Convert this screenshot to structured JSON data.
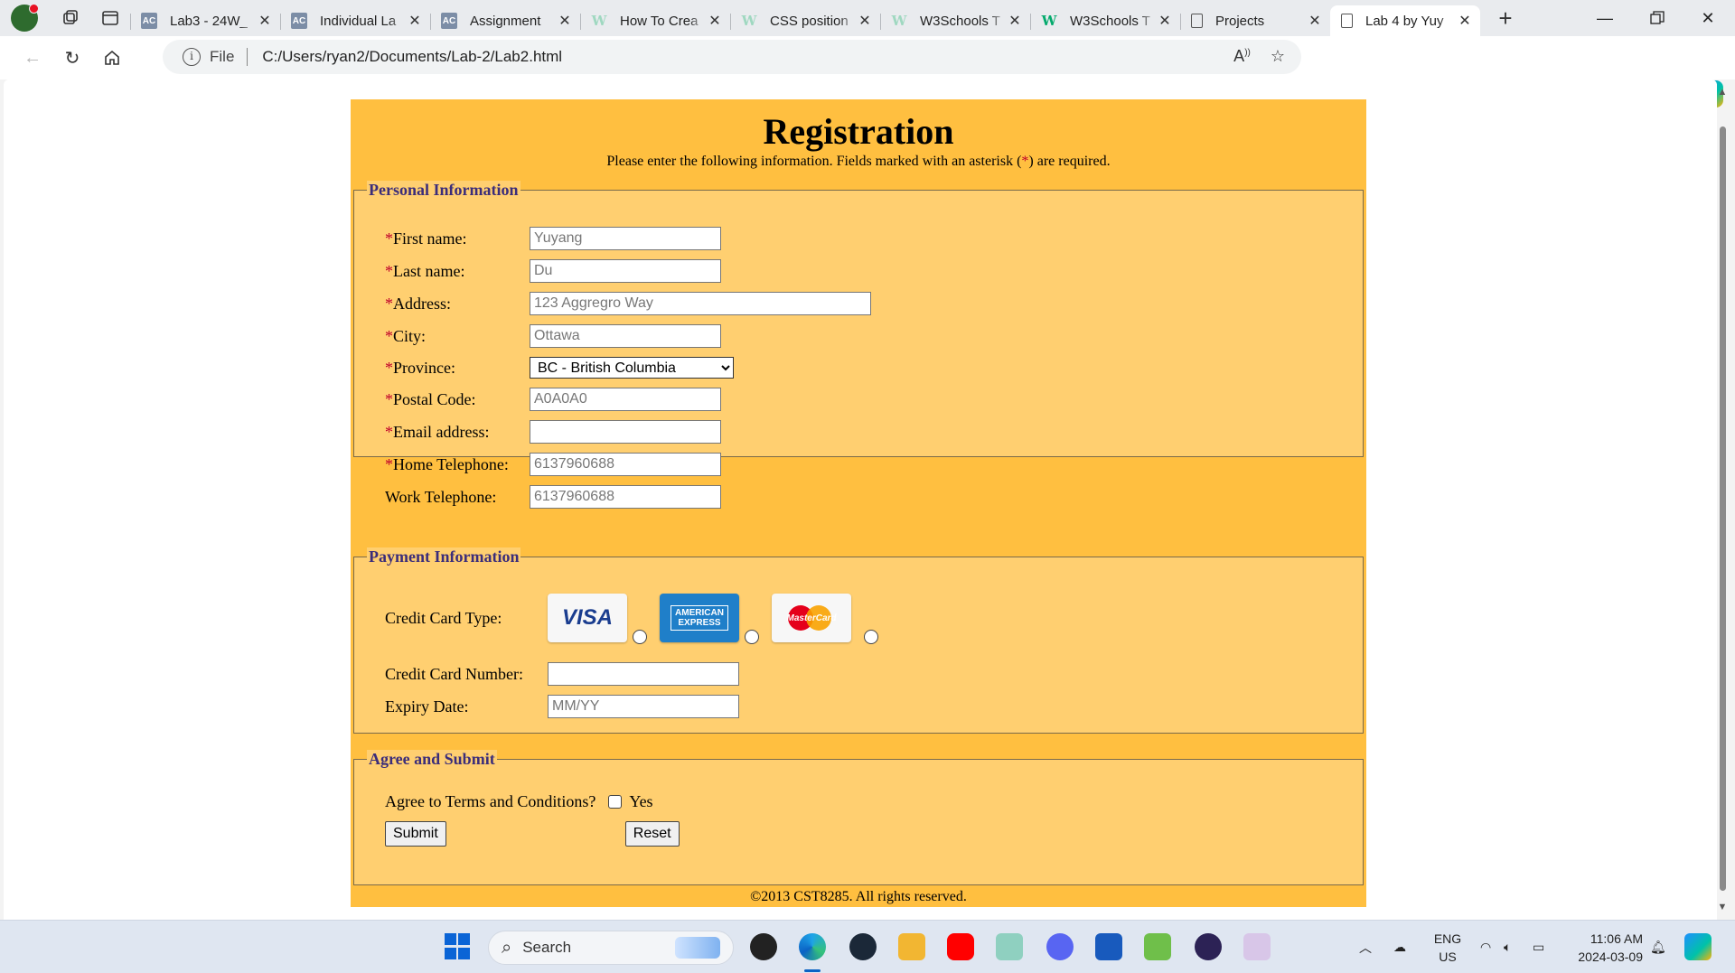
{
  "browser": {
    "tabs": [
      {
        "label": "Lab3 - 24W_",
        "icon": "ac-icon"
      },
      {
        "label": "Individual La",
        "icon": "ac-icon"
      },
      {
        "label": "Assignment",
        "icon": "ac-icon"
      },
      {
        "label": "How To Crea",
        "icon": "w3schools-icon"
      },
      {
        "label": "CSS position",
        "icon": "w3schools-icon"
      },
      {
        "label": "W3Schools T",
        "icon": "w3schools-icon"
      },
      {
        "label": "W3Schools T",
        "icon": "w3schools-icon"
      },
      {
        "label": "Projects",
        "icon": "document-icon"
      },
      {
        "label": "Lab 4 by Yuy",
        "icon": "document-icon",
        "active": true
      }
    ],
    "address": {
      "scheme_label": "File",
      "url": "C:/Users/ryan2/Documents/Lab-2/Lab2.html"
    }
  },
  "form": {
    "title": "Registration",
    "subtitle_pre": "Please enter the following information. Fields marked with an asterisk (",
    "subtitle_star": "*",
    "subtitle_post": ") are required.",
    "asterisk": "*",
    "personal": {
      "legend": "Personal Information",
      "first_name": {
        "label": "First name:",
        "placeholder": "Yuyang"
      },
      "last_name": {
        "label": "Last name:",
        "placeholder": "Du"
      },
      "address": {
        "label": "Address:",
        "placeholder": "123 Aggregro Way"
      },
      "city": {
        "label": "City:",
        "placeholder": "Ottawa"
      },
      "province": {
        "label": "Province:",
        "selected": "BC - British Columbia"
      },
      "postal_code": {
        "label": "Postal Code:",
        "placeholder": "A0A0A0"
      },
      "email": {
        "label": "Email address:",
        "placeholder": ""
      },
      "home_phone": {
        "label": "Home Telephone:",
        "placeholder": "6137960688"
      },
      "work_phone": {
        "label": "Work Telephone:",
        "placeholder": "6137960688"
      }
    },
    "payment": {
      "legend": "Payment Information",
      "card_type_label": "Credit Card Type:",
      "cards": {
        "visa": "VISA",
        "amex_line1": "AMERICAN",
        "amex_line2": "EXPRESS",
        "mastercard": "MasterCard"
      },
      "card_number": {
        "label": "Credit Card Number:",
        "placeholder": ""
      },
      "expiry": {
        "label": "Expiry Date:",
        "placeholder": "MM/YY"
      }
    },
    "agree": {
      "legend": "Agree and Submit",
      "terms_label": "Agree to Terms and Conditions?",
      "yes_label": "Yes",
      "submit_label": "Submit",
      "reset_label": "Reset"
    },
    "footer": "©2013 CST8285. All rights reserved."
  },
  "taskbar": {
    "search_placeholder": "Search",
    "lang_line1": "ENG",
    "lang_line2": "US",
    "time": "11:06 AM",
    "date": "2024-03-09"
  },
  "colors": {
    "page_background": "#ffbf40",
    "fieldset_background": "#ffcf70",
    "legend_text": "#3b2d7a",
    "required_asterisk": "#c0002b"
  }
}
